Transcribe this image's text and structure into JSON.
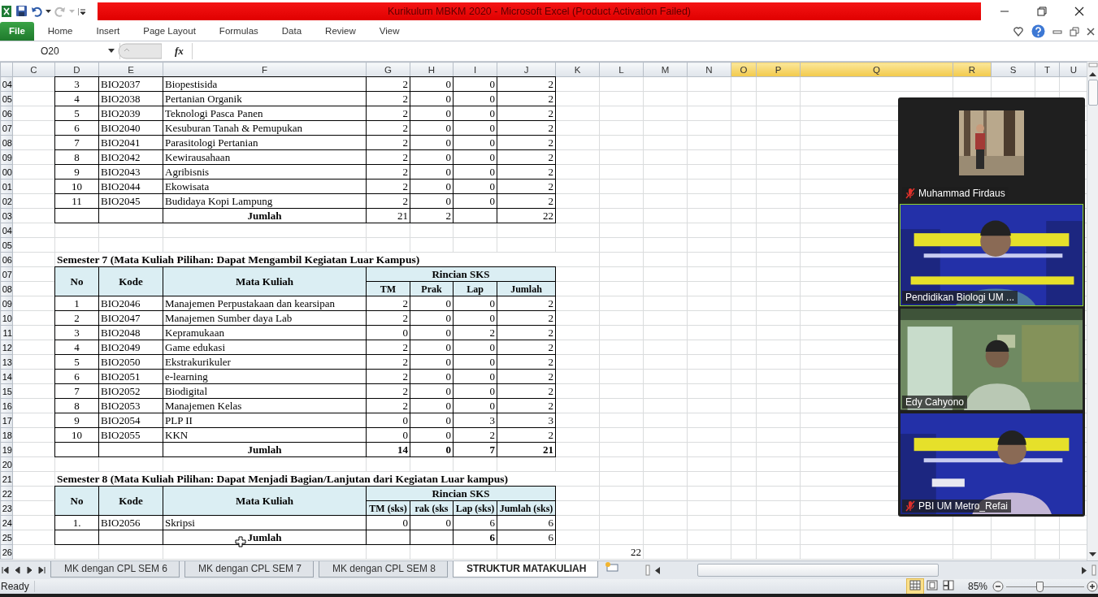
{
  "window": {
    "title": "Kurikulum MBKM 2020 - Microsoft Excel (Product Activation Failed)"
  },
  "ribbon_tabs": [
    {
      "label": "File",
      "kind": "file"
    },
    {
      "label": "Home",
      "kind": "tab"
    },
    {
      "label": "Insert",
      "kind": "tab"
    },
    {
      "label": "Page Layout",
      "kind": "tab"
    },
    {
      "label": "Formulas",
      "kind": "tab"
    },
    {
      "label": "Data",
      "kind": "tab"
    },
    {
      "label": "Review",
      "kind": "tab"
    },
    {
      "label": "View",
      "kind": "tab"
    }
  ],
  "name_box": "O20",
  "formula_label": "fx",
  "sheet": {
    "columns": [
      {
        "label": "C",
        "selected": false
      },
      {
        "label": "D",
        "selected": false
      },
      {
        "label": "E",
        "selected": false
      },
      {
        "label": "F",
        "selected": false
      },
      {
        "label": "G",
        "selected": false
      },
      {
        "label": "H",
        "selected": false
      },
      {
        "label": "I",
        "selected": false
      },
      {
        "label": "J",
        "selected": false
      },
      {
        "label": "K",
        "selected": false
      },
      {
        "label": "L",
        "selected": false
      },
      {
        "label": "M",
        "selected": false
      },
      {
        "label": "N",
        "selected": false
      },
      {
        "label": "O",
        "selected": true
      },
      {
        "label": "P",
        "selected": true
      },
      {
        "label": "Q",
        "selected": true
      },
      {
        "label": "R",
        "selected": true
      },
      {
        "label": "S",
        "selected": false
      },
      {
        "label": "T",
        "selected": false
      },
      {
        "label": "U",
        "selected": false
      }
    ],
    "rows": [
      {
        "header": "04",
        "kind": "data",
        "no": "3",
        "code": "BIO2037",
        "course": "Biopestisida",
        "values": [
          "2",
          "0",
          "0",
          "2"
        ]
      },
      {
        "header": "05",
        "kind": "data",
        "no": "4",
        "code": "BIO2038",
        "course": "Pertanian Organik",
        "values": [
          "2",
          "0",
          "0",
          "2"
        ]
      },
      {
        "header": "06",
        "kind": "data",
        "no": "5",
        "code": "BIO2039",
        "course": "Teknologi Pasca Panen",
        "values": [
          "2",
          "0",
          "0",
          "2"
        ]
      },
      {
        "header": "07",
        "kind": "data",
        "no": "6",
        "code": "BIO2040",
        "course": "Kesuburan Tanah & Pemupukan",
        "values": [
          "2",
          "0",
          "0",
          "2"
        ]
      },
      {
        "header": "08",
        "kind": "data",
        "no": "7",
        "code": "BIO2041",
        "course": "Parasitologi Pertanian",
        "values": [
          "2",
          "0",
          "0",
          "2"
        ]
      },
      {
        "header": "09",
        "kind": "data",
        "no": "8",
        "code": "BIO2042",
        "course": "Kewirausahaan",
        "values": [
          "2",
          "0",
          "0",
          "2"
        ]
      },
      {
        "header": "00",
        "kind": "data",
        "no": "9",
        "code": "BIO2043",
        "course": "Agribisnis",
        "values": [
          "2",
          "0",
          "0",
          "2"
        ]
      },
      {
        "header": "01",
        "kind": "data",
        "no": "10",
        "code": "BIO2044",
        "course": "Ekowisata",
        "values": [
          "2",
          "0",
          "0",
          "2"
        ]
      },
      {
        "header": "02",
        "kind": "data",
        "no": "11",
        "code": "BIO2045",
        "course": "Budidaya Kopi Lampung",
        "values": [
          "2",
          "0",
          "0",
          "2"
        ]
      },
      {
        "header": "03",
        "kind": "total",
        "label": "Jumlah",
        "values": [
          {
            "kind": "number",
            "text": "21",
            "bold": false
          },
          {
            "kind": "number",
            "text": "2",
            "bold": false
          },
          {
            "kind": "blank"
          },
          {
            "kind": "number",
            "text": "22",
            "bold": false
          }
        ]
      },
      {
        "header": "04",
        "kind": "blank"
      },
      {
        "header": "05",
        "kind": "blank"
      },
      {
        "header": "06",
        "kind": "title",
        "text": "Semester 7 (Mata Kuliah Pilihan:  Dapat Mengambil Kegiatan Luar Kampus)"
      },
      {
        "headers": [
          "07",
          "08"
        ],
        "kind": "table_head",
        "no": "No",
        "code": "Kode",
        "course": "Mata Kuliah",
        "group": "Rincian SKS",
        "subcolumns": [
          "TM",
          "Prak",
          "Lap",
          "Jumlah"
        ]
      },
      {
        "header": "09",
        "kind": "data",
        "no": "1",
        "code": "BIO2046",
        "course": "Manajemen Perpustakaan dan kearsipan",
        "values": [
          "2",
          "0",
          "0",
          "2"
        ]
      },
      {
        "header": "10",
        "kind": "data",
        "no": "2",
        "code": "BIO2047",
        "course": "Manajemen Sumber daya Lab",
        "values": [
          "2",
          "0",
          "0",
          "2"
        ]
      },
      {
        "header": "11",
        "kind": "data",
        "no": "3",
        "code": "BIO2048",
        "course": "Kepramukaan",
        "values": [
          "0",
          "0",
          "2",
          "2"
        ]
      },
      {
        "header": "12",
        "kind": "data",
        "no": "4",
        "code": "BIO2049",
        "course": "Game edukasi",
        "values": [
          "2",
          "0",
          "0",
          "2"
        ]
      },
      {
        "header": "13",
        "kind": "data",
        "no": "5",
        "code": "BIO2050",
        "course": "Ekstrakurikuler",
        "values": [
          "2",
          "0",
          "0",
          "2"
        ]
      },
      {
        "header": "14",
        "kind": "data",
        "no": "6",
        "code": "BIO2051",
        "course": "e-learning",
        "values": [
          "2",
          "0",
          "0",
          "2"
        ]
      },
      {
        "header": "15",
        "kind": "data",
        "no": "7",
        "code": "BIO2052",
        "course": "Biodigital",
        "values": [
          "2",
          "0",
          "0",
          "2"
        ]
      },
      {
        "header": "16",
        "kind": "data",
        "no": "8",
        "code": "BIO2053",
        "course": "Manajemen Kelas",
        "values": [
          "2",
          "0",
          "0",
          "2"
        ]
      },
      {
        "header": "17",
        "kind": "data",
        "no": "9",
        "code": "BIO2054",
        "course": "PLP II",
        "values": [
          "0",
          "0",
          "3",
          "3"
        ]
      },
      {
        "header": "18",
        "kind": "data",
        "no": "10",
        "code": "BIO2055",
        "course": "KKN",
        "values": [
          "0",
          "0",
          "2",
          "2"
        ]
      },
      {
        "header": "19",
        "kind": "total",
        "label": "Jumlah",
        "values": [
          {
            "kind": "number",
            "text": "14",
            "bold": true
          },
          {
            "kind": "number",
            "text": "0",
            "bold": true
          },
          {
            "kind": "number",
            "text": "7",
            "bold": true
          },
          {
            "kind": "number",
            "text": "21",
            "bold": true
          }
        ]
      },
      {
        "header": "20",
        "kind": "blank"
      },
      {
        "header": "21",
        "kind": "title",
        "text": "Semester 8 (Mata Kuliah Pilihan: Dapat Menjadi Bagian/Lanjutan dari Kegiatan Luar kampus)"
      },
      {
        "headers": [
          "22",
          "23"
        ],
        "kind": "table_head",
        "no": "No",
        "code": "Kode",
        "course": "Mata Kuliah",
        "group": "Rincian SKS",
        "subcolumns": [
          "TM (sks)",
          "rak (sks",
          "Lap (sks)",
          "Jumlah (sks)"
        ]
      },
      {
        "header": "24",
        "kind": "data",
        "no": "1.",
        "code": "BIO2056",
        "course": "Skripsi",
        "values": [
          "0",
          "0",
          "6",
          "6"
        ]
      },
      {
        "header": "25",
        "kind": "total",
        "label": "Jumlah",
        "values": [
          {
            "kind": "blank"
          },
          {
            "kind": "blank"
          },
          {
            "kind": "number",
            "text": "6",
            "bold": true
          },
          {
            "kind": "number",
            "text": "6",
            "bold": false
          }
        ]
      },
      {
        "header": "26",
        "kind": "note",
        "text": "22"
      }
    ]
  },
  "sheet_tabs": [
    {
      "label": "MK dengan CPL SEM 6",
      "selected": false
    },
    {
      "label": "MK dengan CPL SEM 7",
      "selected": false
    },
    {
      "label": "MK dengan CPL SEM 8",
      "selected": false
    },
    {
      "label": "STRUKTUR MATAKULIAH",
      "selected": true
    }
  ],
  "status_bar": {
    "status": "Ready",
    "views": [
      {
        "kind": "normal",
        "selected": true
      },
      {
        "kind": "page_layout",
        "selected": false
      },
      {
        "kind": "page_break",
        "selected": false
      }
    ],
    "zoom": "85%",
    "zoom_slider": {
      "level": 0.42
    }
  },
  "video_panel": {
    "participants": [
      {
        "name": "Muhammad Firdaus",
        "muted": true,
        "active": false
      },
      {
        "name": "Pendidikan Biologi UM ...",
        "kind": "video",
        "muted": false,
        "active": true
      },
      {
        "name": "Edy Cahyono",
        "kind": "video",
        "muted": false,
        "active": false
      },
      {
        "name": "PBI UM Metro_Refai",
        "kind": "video",
        "muted": true,
        "active": false
      }
    ]
  }
}
